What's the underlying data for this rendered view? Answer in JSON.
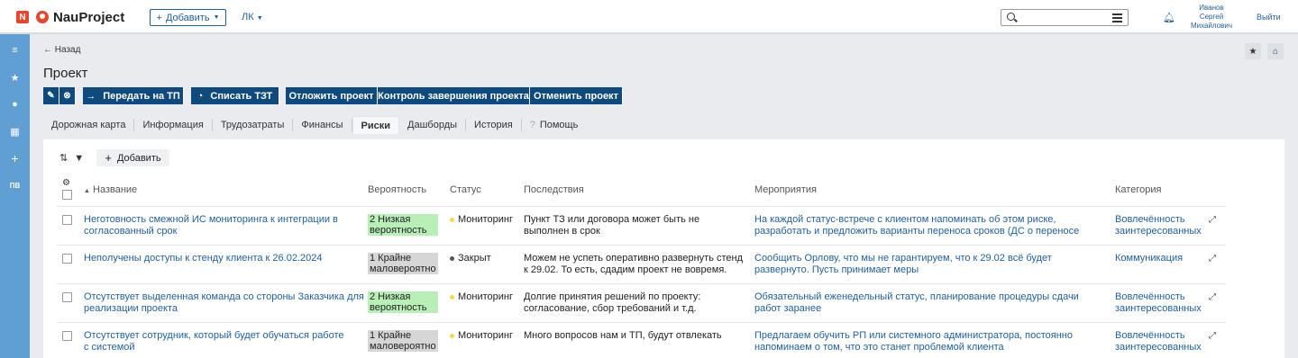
{
  "app": {
    "logo_letter": "N",
    "name": "NauProject",
    "add_label": "Добавить",
    "lk_label": "ЛК",
    "user_name": "Иванов Сергей Михайлович",
    "logout": "Выйти"
  },
  "sidebar": {
    "items": [
      {
        "icon": "menu-icon",
        "glyph": "≡"
      },
      {
        "icon": "star-icon",
        "glyph": "★"
      },
      {
        "icon": "clock-icon",
        "glyph": "●"
      },
      {
        "icon": "grid-icon",
        "glyph": "▦"
      },
      {
        "icon": "plus-icon",
        "glyph": "+"
      },
      {
        "icon": "label",
        "glyph": "ПВ"
      }
    ]
  },
  "header": {
    "back": "Назад",
    "title": "Проект"
  },
  "actions": [
    "Передать на ТП",
    "Списать ТЗТ",
    "Отложить проект",
    "Контроль завершения проекта",
    "Отменить проект"
  ],
  "tabs": [
    "Дорожная карта",
    "Информация",
    "Трудозатраты",
    "Финансы",
    "Риски",
    "Дашборды",
    "История",
    "Помощь"
  ],
  "active_tab": "Риски",
  "toolbar": {
    "add_label": "Добавить"
  },
  "table": {
    "columns": [
      "Название",
      "Вероятность",
      "Статус",
      "Последствия",
      "Мероприятия",
      "Категория"
    ],
    "rows": [
      {
        "name": "Неготовность смежной ИС мониторинга к интеграции в согласованный срок",
        "probability": "2 Низкая вероятность",
        "probability_color": "#b7efb7",
        "status": "Мониторинг",
        "status_color": "#f2d84a",
        "consequences": "Пункт ТЗ или договора может быть не выполнен в срок",
        "measures": "На каждой статус-встрече с клиентом напоминать об этом риске, разработать и предложить варианты переноса сроков (ДС о переносе",
        "category": "Вовлечённость заинтересованных"
      },
      {
        "name": "Неполучены доступы к стенду клиента к 26.02.2024",
        "probability": "1 Крайне маловероятно",
        "probability_color": "#d6d6d6",
        "status": "Закрыт",
        "status_color": "#555555",
        "consequences": "Можем не успеть оперативно развернуть стенд к 29.02. То есть, сдадим проект не вовремя.",
        "measures": "Сообщить Орлову, что мы не гарантируем, что к 29.02 всё будет развернуто. Пусть принимает меры",
        "category": "Коммуникация"
      },
      {
        "name": "Отсутствует выделенная команда со стороны Заказчика для реализации проекта",
        "probability": "2 Низкая вероятность",
        "probability_color": "#b7efb7",
        "status": "Мониторинг",
        "status_color": "#f2d84a",
        "consequences": "Долгие принятия решений по проекту: согласование, сбор требований и т.д.",
        "measures": "Обязательный еженедельный статус, планирование процедуры сдачи работ заранее",
        "category": "Вовлечённость заинтересованных"
      },
      {
        "name": "Отсутствует сотрудник, который будет обучаться работе с системой",
        "probability": "1 Крайне маловероятно",
        "probability_color": "#d6d6d6",
        "status": "Мониторинг",
        "status_color": "#f2d84a",
        "consequences": "Много вопросов нам и ТП, будут отвлекать",
        "measures": "Предлагаем обучить РП или системного администратора, постоянно напоминаем о том, что это станет проблемой клиента",
        "category": "Вовлечённость заинтересованных"
      }
    ]
  }
}
